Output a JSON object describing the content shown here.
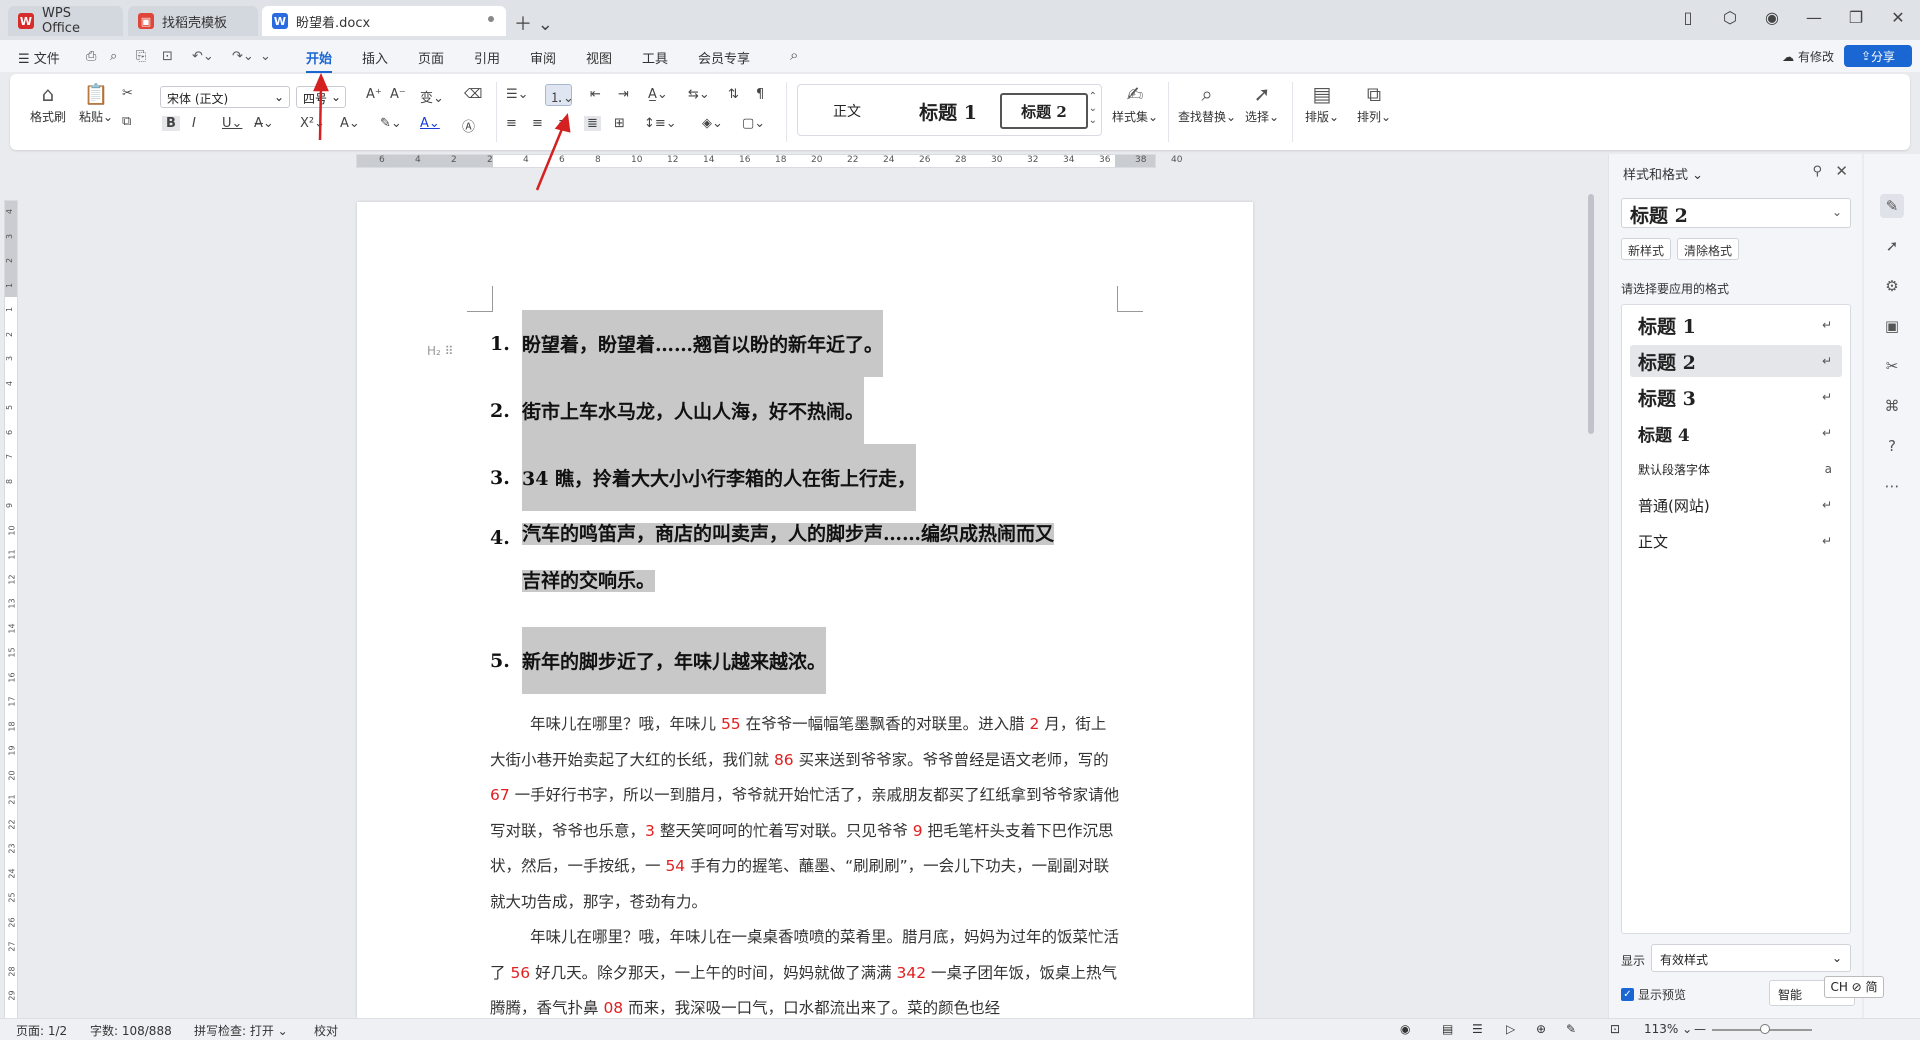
{
  "tabs": [
    {
      "label": "WPS Office"
    },
    {
      "label": "找稻壳模板"
    },
    {
      "label": "盼望着.docx"
    }
  ],
  "menu": {
    "file": "文件",
    "items": [
      "开始",
      "插入",
      "页面",
      "引用",
      "审阅",
      "视图",
      "工具",
      "会员专享"
    ],
    "active": "开始",
    "has_changes": "有修改",
    "share": "分享"
  },
  "ribbon": {
    "format_painter": "格式刷",
    "paste": "粘贴",
    "font_name": "宋体 (正文)",
    "font_size": "四号",
    "styles": {
      "normal": "正文",
      "h1": "标题 1",
      "h2": "标题 2"
    },
    "style_set": "样式集",
    "find_replace": "查找替换",
    "select": "选择",
    "layout": "排版",
    "arrange": "排列"
  },
  "ruler": {
    "h_ticks": [
      "6",
      "4",
      "2",
      "2",
      "4",
      "6",
      "8",
      "10",
      "12",
      "14",
      "16",
      "18",
      "20",
      "22",
      "24",
      "26",
      "28",
      "30",
      "32",
      "34",
      "36",
      "38",
      "40"
    ],
    "v_ticks": [
      "4",
      "3",
      "2",
      "1",
      "1",
      "2",
      "3",
      "4",
      "5",
      "6",
      "7",
      "8",
      "9",
      "10",
      "11",
      "12",
      "13",
      "14",
      "15",
      "16",
      "17",
      "18",
      "19",
      "20",
      "21",
      "22",
      "23",
      "24",
      "25",
      "26",
      "27",
      "28",
      "29"
    ]
  },
  "document": {
    "heading_marker": "H₂",
    "list": [
      {
        "num": "1.",
        "text": "盼望着，盼望着……翘首以盼的新年近了。"
      },
      {
        "num": "2.",
        "text": "街市上车水马龙，人山人海，好不热闹。"
      },
      {
        "num": "3.",
        "text": "34 瞧，拎着大大小小行李箱的人在街上行走，"
      },
      {
        "num": "4.",
        "line1": "汽车的鸣笛声，商店的叫卖声，人的脚步声……编织成热闹而又",
        "line2": "吉祥的交响乐。"
      },
      {
        "num": "5.",
        "text": "新年的脚步近了，年味儿越来越浓。"
      }
    ],
    "para1": [
      {
        "t": "年味儿在哪里？哦，年味儿 "
      },
      {
        "t": "55",
        "red": true
      },
      {
        "t": " 在爷爷一幅幅笔墨飘香的对联里。进入腊 "
      },
      {
        "t": "2",
        "red": true
      },
      {
        "t": " 月，街上大街小巷开始卖起了大红的长纸，我们就 "
      },
      {
        "t": "86",
        "red": true
      },
      {
        "t": " 买来送到爷爷家。爷爷曾经是语文老师，写的 "
      },
      {
        "t": "67",
        "red": true
      },
      {
        "t": " 一手好行书字，所以一到腊月，爷爷就开始忙活了，亲戚朋友都买了红纸拿到爷爷家请他写对联，爷爷也乐意，"
      },
      {
        "t": "3",
        "red": true
      },
      {
        "t": " 整天笑呵呵的忙着写对联。只见爷爷 "
      },
      {
        "t": "9",
        "red": true
      },
      {
        "t": " 把毛笔杆头支着下巴作沉思状，然后，一手按纸，一 "
      },
      {
        "t": "54",
        "red": true
      },
      {
        "t": " 手有力的握笔、蘸墨、“刷刷刷”，一会儿下功夫，一副副对联就大功告成，那字，苍劲有力。"
      }
    ],
    "para2": [
      {
        "t": "年味儿在哪里？哦，年味儿在一桌桌香喷喷的菜肴里。腊月底，妈妈为过年的饭菜忙活了 "
      },
      {
        "t": "56",
        "red": true
      },
      {
        "t": " 好几天。除夕那天，一上午的时间，妈妈就做了满满 "
      },
      {
        "t": "342",
        "red": true
      },
      {
        "t": " 一桌子团年饭，饭桌上热气腾腾，香气扑鼻 "
      },
      {
        "t": "08",
        "red": true
      },
      {
        "t": " 而来，我深吸一口气，口水都流出来了。菜的颜色也经"
      }
    ]
  },
  "panel": {
    "title": "样式和格式",
    "current_style": "标题 2",
    "new_style": "新样式",
    "clear_format": "清除格式",
    "prompt": "请选择要应用的格式",
    "styles": [
      {
        "label": "标题 1",
        "kind": "h",
        "mark": "↵"
      },
      {
        "label": "标题 2",
        "kind": "h",
        "mark": "↵",
        "selected": true
      },
      {
        "label": "标题 3",
        "kind": "h",
        "mark": "↵"
      },
      {
        "label": "标题 4",
        "kind": "h",
        "mark": "↵"
      },
      {
        "label": "默认段落字体",
        "kind": "s",
        "mark": "a"
      },
      {
        "label": "普通(网站)",
        "kind": "n",
        "mark": "↵"
      },
      {
        "label": "正文",
        "kind": "n",
        "mark": "↵"
      }
    ],
    "show_label": "显示",
    "show_value": "有效样式",
    "preview_label": "显示预览",
    "smart_label": "智能"
  },
  "ime": "CH ⊘ 简",
  "status": {
    "page": "页面: 1/2",
    "words": "字数: 108/888",
    "spell": "拼写检查: 打开",
    "proof": "校对",
    "zoom": "113%"
  },
  "colors": {
    "accent": "#1a66d2",
    "red_number": "#e02020",
    "selection": "#c8c8c8",
    "annotation": "#d42020"
  }
}
